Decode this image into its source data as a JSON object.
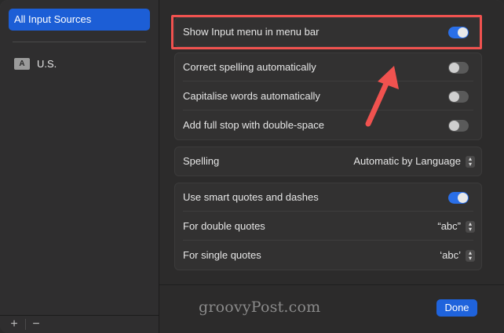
{
  "sidebar": {
    "selected_label": "All Input Sources",
    "sources": [
      {
        "badge": "A",
        "label": "U.S."
      }
    ],
    "add_label": "+",
    "remove_label": "−"
  },
  "top_setting": {
    "label": "Show Input menu in menu bar",
    "on": true
  },
  "checks": [
    {
      "label": "Correct spelling automatically",
      "on": false
    },
    {
      "label": "Capitalise words automatically",
      "on": false
    },
    {
      "label": "Add full stop with double-space",
      "on": false
    }
  ],
  "spelling": {
    "label": "Spelling",
    "value": "Automatic by Language"
  },
  "quotes": {
    "smart_label": "Use smart quotes and dashes",
    "smart_on": true,
    "double_label": "For double quotes",
    "double_value": "“abc”",
    "single_label": "For single quotes",
    "single_value": "‘abc’"
  },
  "footer": {
    "done_label": "Done"
  },
  "watermark": "groovyPost.com",
  "colors": {
    "accent": "#2a6fe8",
    "highlight": "#f0524f"
  }
}
